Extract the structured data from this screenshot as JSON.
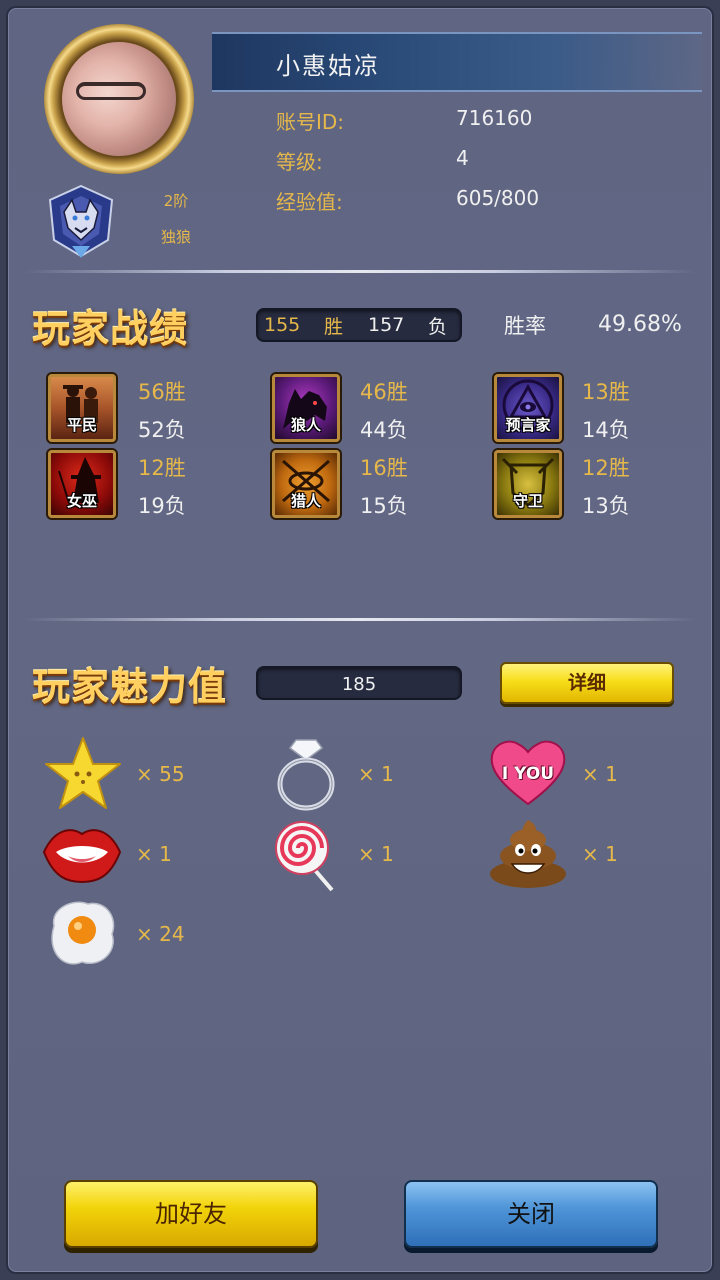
{
  "profile": {
    "name": "小惠姑凉",
    "id_label": "账号ID:",
    "id_value": "716160",
    "level_label": "等级:",
    "level_value": "4",
    "exp_label": "经验值:",
    "exp_value": "605/800",
    "rank_tier": "2阶",
    "rank_title": "独狼"
  },
  "record": {
    "title": "玩家战绩",
    "wins": "155",
    "win_label": "胜",
    "losses": "157",
    "loss_label": "负",
    "rate_label": "胜率",
    "rate_value": "49.68%",
    "roles": [
      {
        "name": "平民",
        "wins": "56胜",
        "losses": "52负",
        "icon": "civilian-icon"
      },
      {
        "name": "狼人",
        "wins": "46胜",
        "losses": "44负",
        "icon": "werewolf-icon"
      },
      {
        "name": "预言家",
        "wins": "13胜",
        "losses": "14负",
        "icon": "seer-icon"
      },
      {
        "name": "女巫",
        "wins": "12胜",
        "losses": "19负",
        "icon": "witch-icon"
      },
      {
        "name": "猎人",
        "wins": "16胜",
        "losses": "15负",
        "icon": "hunter-icon"
      },
      {
        "name": "守卫",
        "wins": "12胜",
        "losses": "13负",
        "icon": "guard-icon"
      }
    ]
  },
  "charm": {
    "title": "玩家魅力值",
    "value": "185",
    "detail_label": "详细",
    "gifts": [
      {
        "icon": "star-icon",
        "count": "× 55"
      },
      {
        "icon": "diamond-ring-icon",
        "count": "× 1"
      },
      {
        "icon": "i-love-you-heart-icon",
        "count": "× 1",
        "heart_text": "I YOU"
      },
      {
        "icon": "lips-icon",
        "count": "× 1"
      },
      {
        "icon": "lollipop-icon",
        "count": "× 1"
      },
      {
        "icon": "poop-icon",
        "count": "× 1"
      },
      {
        "icon": "fried-egg-icon",
        "count": "× 24"
      }
    ]
  },
  "actions": {
    "add_friend": "加好友",
    "close": "关闭"
  }
}
